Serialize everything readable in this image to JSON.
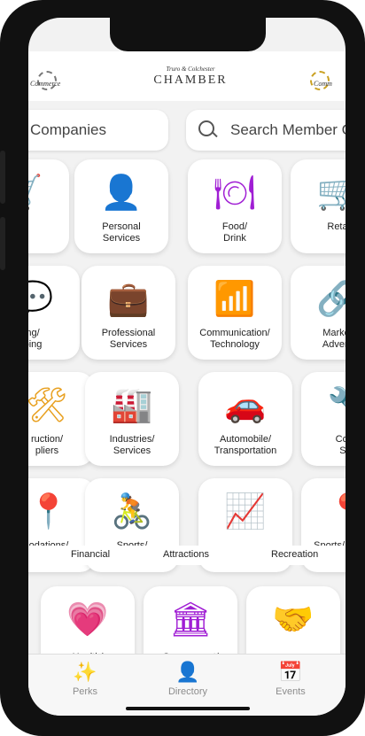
{
  "header": {
    "logo_sub": "Truro & Colchester",
    "logo_main": "CHAMBER",
    "left_word": "Commerce",
    "right_word": "Comm"
  },
  "search": {
    "left_text": "Companies",
    "right_placeholder": "Search Member C"
  },
  "rows": [
    [
      {
        "label": "",
        "icon": "cart-icon",
        "glyph": "🛒",
        "color": "purple"
      },
      {
        "label": "Personal\nServices",
        "icon": "person-icon",
        "glyph": "👤",
        "color": "purple"
      },
      {
        "label": "Food/\nDrink",
        "icon": "plate-icon",
        "glyph": "🍽",
        "color": "purple"
      },
      {
        "label": "Reta",
        "icon": "cart-icon",
        "glyph": "🛒",
        "color": "purple"
      }
    ],
    [
      {
        "label": "ng/\nping",
        "icon": "bubble-icon",
        "glyph": "💬",
        "color": "purple"
      },
      {
        "label": "Professional\nServices",
        "icon": "briefcase-icon",
        "glyph": "💼",
        "color": "purple"
      },
      {
        "label": "Communication/\nTechnology",
        "icon": "wifi-icon",
        "glyph": "📶",
        "color": "purple"
      },
      {
        "label": "Market\nAdverti",
        "icon": "network-icon",
        "glyph": "🔗",
        "color": "purple"
      }
    ],
    [
      {
        "label": "ruction/\npliers",
        "icon": "tools-icon",
        "glyph": "🛠",
        "color": "gold"
      },
      {
        "label": "Industries/\nServices",
        "icon": "factory-icon",
        "glyph": "🏭",
        "color": "gold"
      },
      {
        "label": "Automobile/\nTransportation",
        "icon": "car-repair-icon",
        "glyph": "🚗",
        "color": "gold"
      },
      {
        "label": "Const\nSup",
        "icon": "tools-icon",
        "glyph": "🔧",
        "color": "gold"
      }
    ],
    [
      {
        "label": "odations/",
        "icon": "pin-icon",
        "glyph": "📍",
        "color": "gold"
      },
      {
        "label": "Sports/",
        "icon": "bicycle-icon",
        "glyph": "🚴",
        "color": "gold"
      },
      {
        "label": "",
        "icon": "growth-chart-icon",
        "glyph": "📈",
        "color": "gold"
      },
      {
        "label": "Sports/Accomm",
        "icon": "pin-icon",
        "glyph": "📍",
        "color": "gold"
      }
    ]
  ],
  "overlay": {
    "a": "Financial",
    "b": "Attractions",
    "c": "Recreation"
  },
  "bottom_row": [
    {
      "label": "Health/",
      "icon": "health-hand-icon",
      "glyph": "💗"
    },
    {
      "label": "Government/",
      "icon": "government-icon",
      "glyph": "🏛"
    },
    {
      "label": "",
      "icon": "handshake-icon",
      "glyph": "🤝"
    }
  ],
  "tabs": [
    {
      "label": "Perks",
      "icon": "perks-icon",
      "glyph": "✨"
    },
    {
      "label": "Directory",
      "icon": "directory-icon",
      "glyph": "👤"
    },
    {
      "label": "Events",
      "icon": "calendar-icon",
      "glyph": "📅"
    }
  ]
}
